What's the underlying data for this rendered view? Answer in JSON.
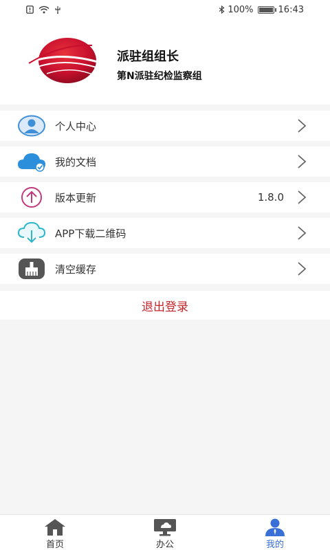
{
  "status_bar": {
    "battery_text": "100%",
    "battery_level": 1.0,
    "time": "16:43"
  },
  "profile": {
    "name": "派驻组组长",
    "organization": "第N派驻纪检监察组",
    "logo_icon": "red-globe-logo-icon",
    "brand_color": "#c8102e"
  },
  "menu": {
    "items": [
      {
        "label": "个人中心",
        "icon": "user-avatar-icon",
        "value": ""
      },
      {
        "label": "我的文档",
        "icon": "cloud-check-icon",
        "value": ""
      },
      {
        "label": "版本更新",
        "icon": "upload-arrow-icon",
        "value": "1.8.0"
      },
      {
        "label": "APP下载二维码",
        "icon": "cloud-download-icon",
        "value": ""
      },
      {
        "label": "清空缓存",
        "icon": "broom-icon",
        "value": ""
      }
    ],
    "logout_label": "退出登录",
    "logout_color": "#c6242b"
  },
  "tabbar": {
    "tabs": [
      {
        "label": "首页",
        "icon": "home-icon"
      },
      {
        "label": "办公",
        "icon": "office-monitor-icon"
      },
      {
        "label": "我的",
        "icon": "person-icon",
        "active": true
      }
    ],
    "active_color": "#3b6fd8"
  }
}
